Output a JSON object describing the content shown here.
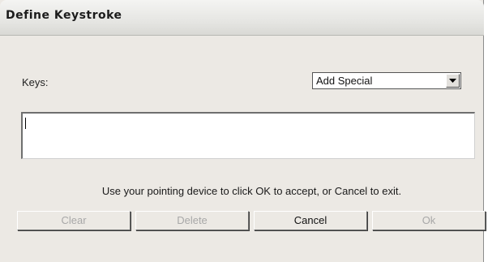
{
  "window": {
    "title": "Define Keystroke"
  },
  "keys": {
    "label": "Keys:",
    "value": ""
  },
  "special_select": {
    "selected": "Add Special"
  },
  "instructions": "Use your pointing device to click OK to accept, or Cancel to exit.",
  "buttons": {
    "clear": "Clear",
    "delete": "Delete",
    "cancel": "Cancel",
    "ok": "Ok"
  }
}
